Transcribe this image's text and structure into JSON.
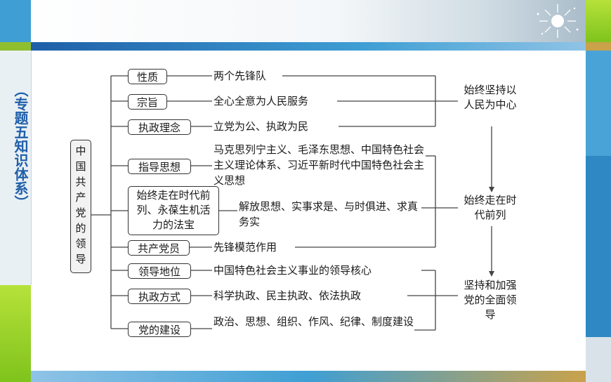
{
  "side_title": "（专题五知识体系）",
  "root": "中国共产党的领导",
  "categories": [
    "性质",
    "宗旨",
    "执政理念",
    "指导思想",
    "始终走在时代前列、永葆生机活力的法宝",
    "共产党员",
    "领导地位",
    "执政方式",
    "党的建设"
  ],
  "details": [
    "两个先锋队",
    "全心全意为人民服务",
    "立党为公、执政为民",
    "马克思列宁主义、毛泽东思想、中国特色社会主义理论体系、习近平新时代中国特色社会主义思想",
    "解放思想、实事求是、与时俱进、求真务实",
    "先锋模范作用",
    "中国特色社会主义事业的领导核心",
    "科学执政、民主执政、依法执政",
    "政治、思想、组织、作风、纪律、制度建设"
  ],
  "outcomes": [
    "始终坚持以人民为中心",
    "始终走在时代前列",
    "坚持和加强党的全面领导"
  ]
}
